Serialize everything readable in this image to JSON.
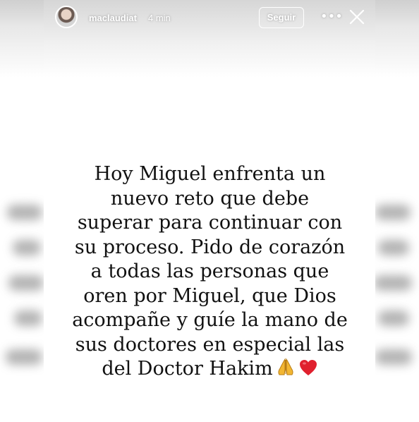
{
  "story": {
    "username": "maclaudiat",
    "time": "4 min",
    "follow_label": "Seguir",
    "more_icon": "more-horizontal-icon",
    "close_icon": "close-icon",
    "text_lines": [
      "Hoy Miguel enfrenta un",
      "nuevo reto que debe",
      "superar para continuar con",
      "su proceso. Pido de corazón",
      "a todas las personas que",
      "oren por Miguel, que Dios",
      "acompañe y guíe la mano de",
      "sus doctores en especial las",
      "del Doctor Hakim"
    ],
    "emojis": [
      "praying-hands-icon",
      "red-heart-icon"
    ]
  },
  "colors": {
    "text": "#111111",
    "background": "#ffffff",
    "heart": "#e0202e",
    "hands": "#f2b632"
  }
}
